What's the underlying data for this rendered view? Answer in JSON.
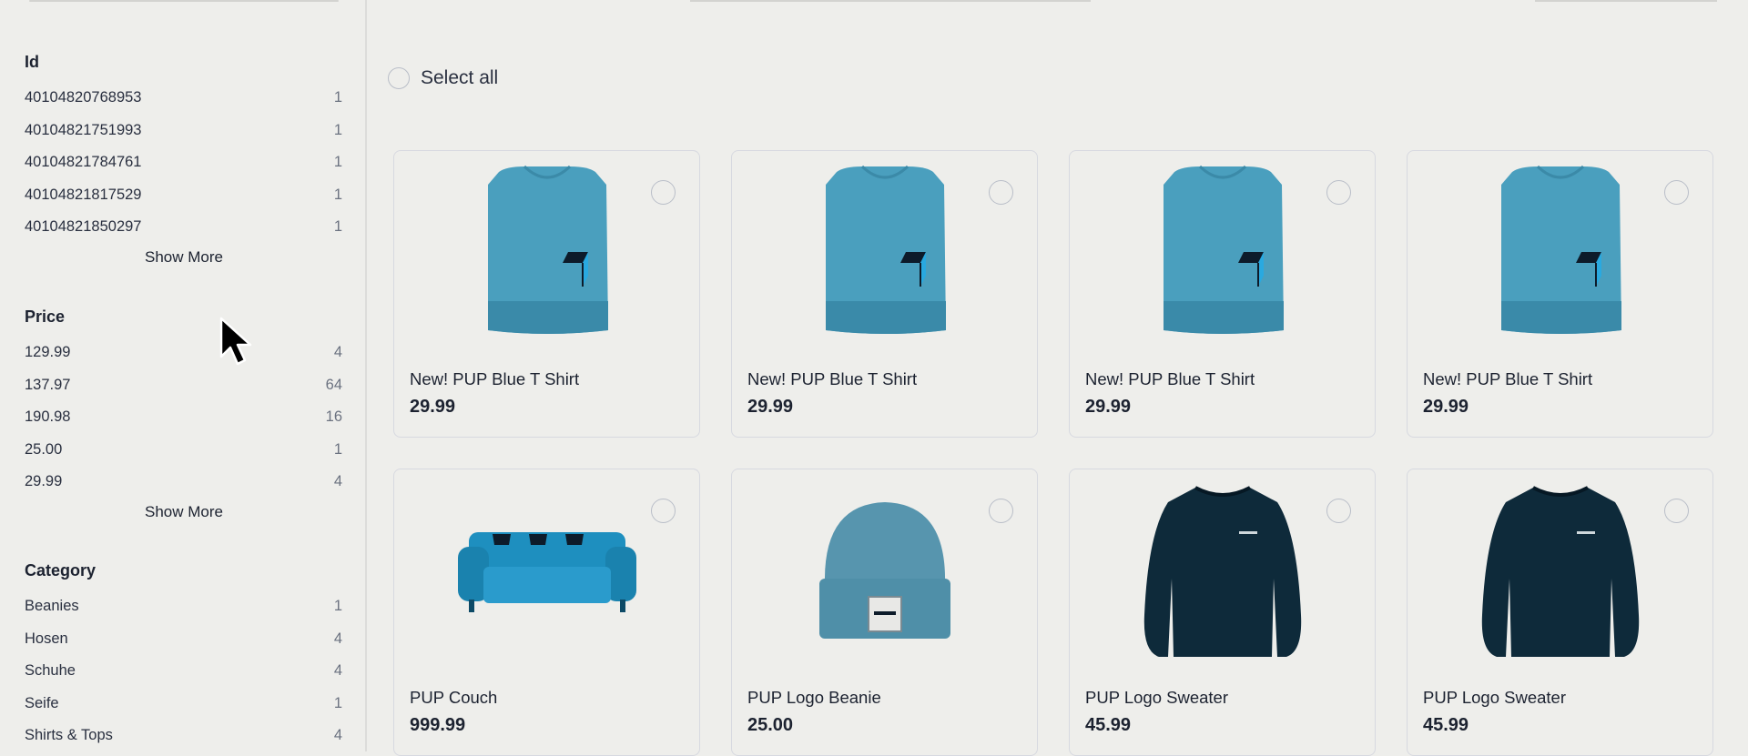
{
  "sidebar": {
    "facets": [
      {
        "title": "Id",
        "items": [
          {
            "label": "40104820768953",
            "count": "1"
          },
          {
            "label": "40104821751993",
            "count": "1"
          },
          {
            "label": "40104821784761",
            "count": "1"
          },
          {
            "label": "40104821817529",
            "count": "1"
          },
          {
            "label": "40104821850297",
            "count": "1"
          }
        ],
        "show_more": "Show More"
      },
      {
        "title": "Price",
        "items": [
          {
            "label": "129.99",
            "count": "4"
          },
          {
            "label": "137.97",
            "count": "64"
          },
          {
            "label": "190.98",
            "count": "16"
          },
          {
            "label": "25.00",
            "count": "1"
          },
          {
            "label": "29.99",
            "count": "4"
          }
        ],
        "show_more": "Show More"
      },
      {
        "title": "Category",
        "items": [
          {
            "label": "Beanies",
            "count": "1"
          },
          {
            "label": "Hosen",
            "count": "4"
          },
          {
            "label": "Schuhe",
            "count": "4"
          },
          {
            "label": "Seife",
            "count": "1"
          },
          {
            "label": "Shirts & Tops",
            "count": "4"
          }
        ]
      }
    ]
  },
  "main": {
    "select_all": "Select all",
    "products": [
      {
        "title": "New! PUP Blue T Shirt",
        "price": "29.99",
        "image": "tshirt"
      },
      {
        "title": "New! PUP Blue T Shirt",
        "price": "29.99",
        "image": "tshirt"
      },
      {
        "title": "New! PUP Blue T Shirt",
        "price": "29.99",
        "image": "tshirt"
      },
      {
        "title": "New! PUP Blue T Shirt",
        "price": "29.99",
        "image": "tshirt"
      },
      {
        "title": "PUP Couch",
        "price": "999.99",
        "image": "couch"
      },
      {
        "title": "PUP Logo Beanie",
        "price": "25.00",
        "image": "beanie"
      },
      {
        "title": "PUP Logo Sweater",
        "price": "45.99",
        "image": "sweater"
      },
      {
        "title": "PUP Logo Sweater",
        "price": "45.99",
        "image": "sweater"
      }
    ]
  },
  "colors": {
    "background": "#eeeeeb",
    "tshirt": "#4a9fbe",
    "couch": "#1e8fbf",
    "beanie": "#4f8fa8",
    "sweater": "#0e2a3a"
  }
}
